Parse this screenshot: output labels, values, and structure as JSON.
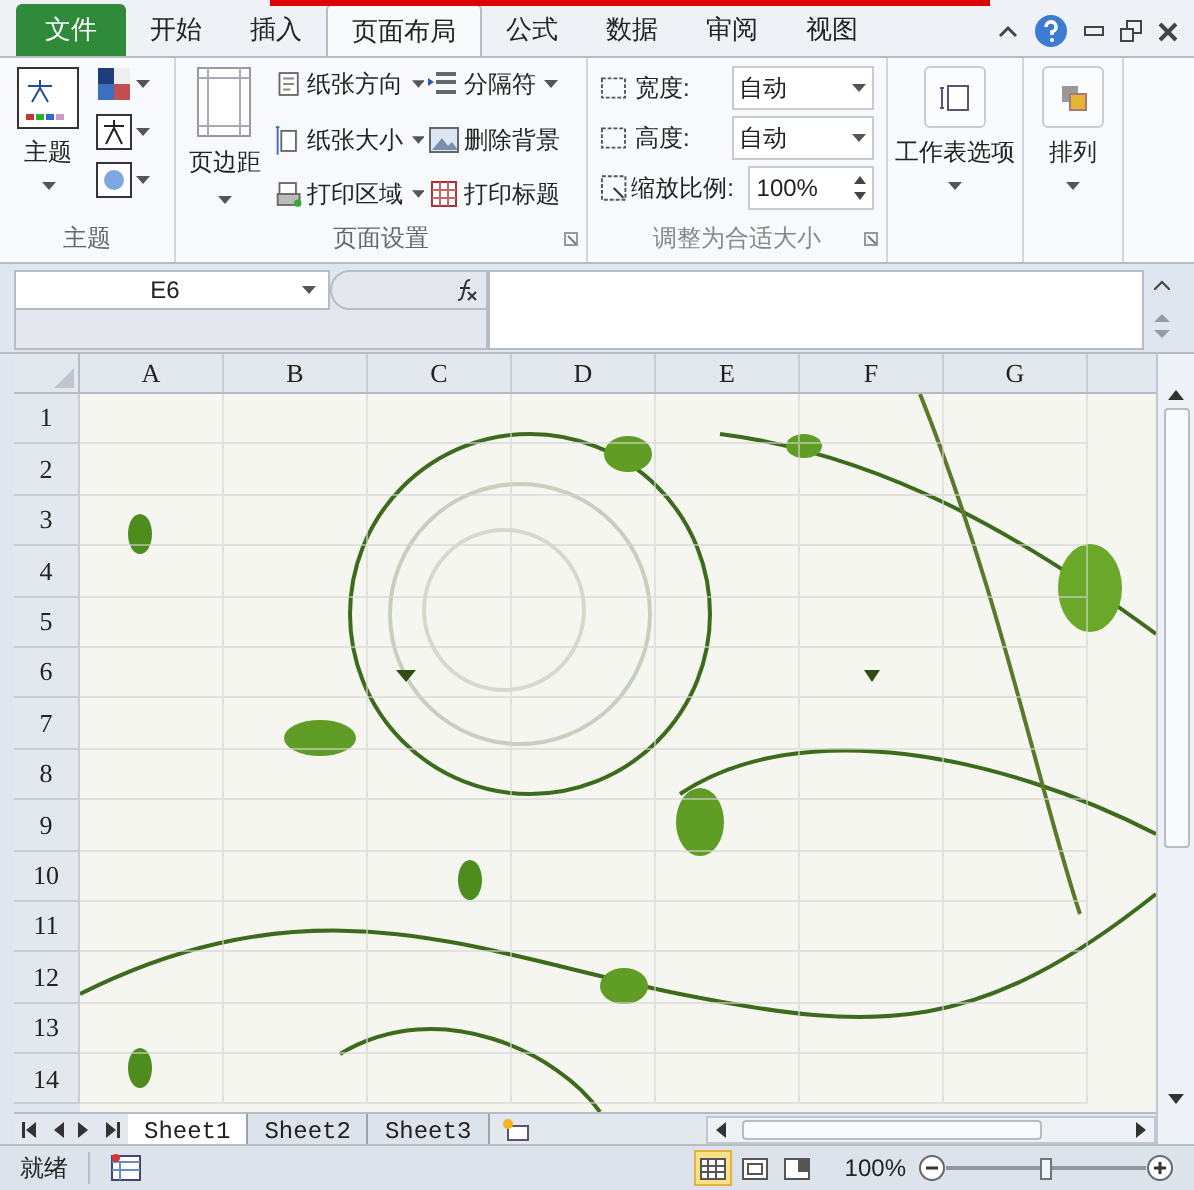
{
  "file_tab": "文件",
  "tabs": [
    {
      "label": "开始",
      "selected": false
    },
    {
      "label": "插入",
      "selected": false
    },
    {
      "label": "页面布局",
      "selected": true
    },
    {
      "label": "公式",
      "selected": false
    },
    {
      "label": "数据",
      "selected": false
    },
    {
      "label": "审阅",
      "selected": false
    },
    {
      "label": "视图",
      "selected": false
    }
  ],
  "ribbon": {
    "themes": {
      "button": "主题",
      "label": "主题"
    },
    "page_setup": {
      "margins": "页边距",
      "label": "页面设置",
      "commands": [
        {
          "label": "纸张方向",
          "has_menu": true
        },
        {
          "label": "纸张大小",
          "has_menu": true
        },
        {
          "label": "打印区域",
          "has_menu": true
        },
        {
          "label": "分隔符",
          "has_menu": true
        },
        {
          "label": "删除背景",
          "has_menu": false
        },
        {
          "label": "打印标题",
          "has_menu": false
        }
      ]
    },
    "scale": {
      "label": "调整为合适大小",
      "width_label": "宽度:",
      "width_value": "自动",
      "height_label": "高度:",
      "height_value": "自动",
      "scale_label": "缩放比例:",
      "scale_value": "100%"
    },
    "sheet_options": "工作表选项",
    "arrange": "排列"
  },
  "name_box": "E6",
  "columns": [
    "A",
    "B",
    "C",
    "D",
    "E",
    "F",
    "G"
  ],
  "rows": [
    "1",
    "2",
    "3",
    "4",
    "5",
    "6",
    "7",
    "8",
    "9",
    "10",
    "11",
    "12",
    "13",
    "14"
  ],
  "sheet_tabs": [
    {
      "label": "Sheet1",
      "selected": true
    },
    {
      "label": "Sheet2",
      "selected": false
    },
    {
      "label": "Sheet3",
      "selected": false
    }
  ],
  "status_bar": {
    "status": "就绪",
    "views": [
      {
        "kind": "normal",
        "selected": true
      },
      {
        "kind": "layout",
        "selected": false
      },
      {
        "kind": "pagebreak",
        "selected": false
      }
    ],
    "zoom": "100%",
    "zoom_slider": {
      "level": 0.5
    }
  }
}
